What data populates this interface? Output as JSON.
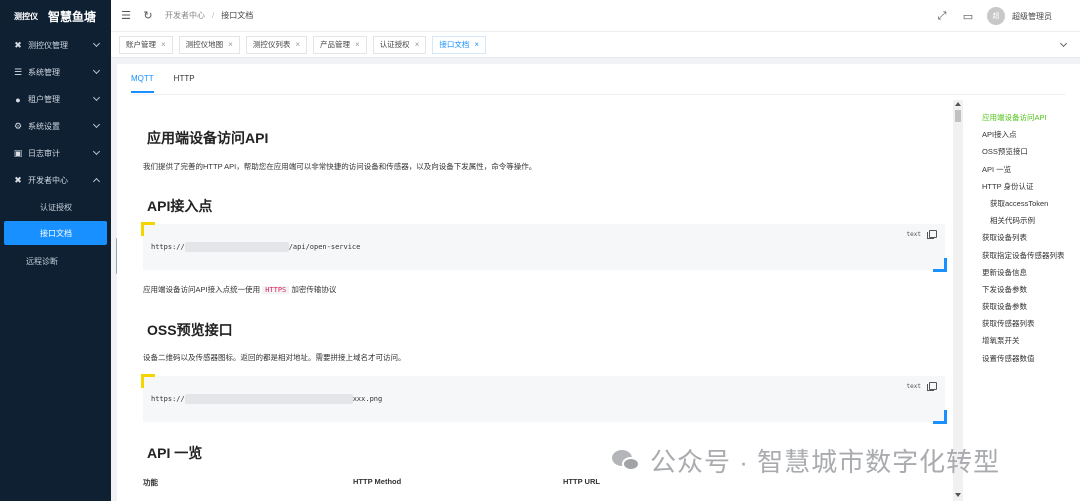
{
  "brand": {
    "small": "测控仪",
    "title": "智慧鱼塘"
  },
  "sidebar": {
    "items": [
      {
        "label": "测控仪管理",
        "icon": "tools-icon"
      },
      {
        "label": "系统管理",
        "icon": "sliders-icon"
      },
      {
        "label": "租户管理",
        "icon": "users-icon"
      },
      {
        "label": "系统设置",
        "icon": "gear-icon"
      },
      {
        "label": "日志审计",
        "icon": "calendar-icon"
      },
      {
        "label": "开发者中心",
        "icon": "tools-icon"
      }
    ],
    "sub_items": [
      {
        "label": "认证授权"
      },
      {
        "label": "接口文档"
      }
    ],
    "diag": {
      "label": "远程诊断"
    }
  },
  "topbar": {
    "breadcrumb": [
      "开发者中心",
      "接口文档"
    ],
    "separator": "/",
    "user": {
      "avatar_text": "超",
      "name": "超级管理员"
    }
  },
  "tabs": [
    {
      "label": "账户管理",
      "close": "×"
    },
    {
      "label": "测控仪地图",
      "close": "×"
    },
    {
      "label": "测控仪列表",
      "close": "×"
    },
    {
      "label": "产品管理",
      "close": "×"
    },
    {
      "label": "认证授权",
      "close": "×"
    },
    {
      "label": "接口文档",
      "close": "×"
    }
  ],
  "protocol_tabs": [
    "MQTT",
    "HTTP"
  ],
  "doc": {
    "h1": "应用端设备访问API",
    "intro": "我们提供了完善的HTTP API，帮助您在应用端可以非常快捷的访问设备和传感器，以及向设备下发属性，命令等操作。",
    "h2_endpoint": "API接入点",
    "code1": {
      "prefix": "https://",
      "suffix": "/api/open-service",
      "lang": "text"
    },
    "endpoint_note_pre": "应用端设备访问API接入点统一使用",
    "endpoint_note_code": "HTTPS",
    "endpoint_note_post": "加密传输协议",
    "h2_oss": "OSS预览接口",
    "oss_desc": "设备二维码以及传感器图标。返回的都是相对地址。需要拼接上域名才可访问。",
    "code2": {
      "prefix": "https://",
      "suffix": "xxx.png",
      "lang": "text"
    },
    "h2_list": "API 一览",
    "table_headers": [
      "功能",
      "HTTP Method",
      "HTTP URL"
    ]
  },
  "toc": [
    {
      "label": "应用端设备访问API",
      "active": true
    },
    {
      "label": "API接入点"
    },
    {
      "label": "OSS预览接口"
    },
    {
      "label": "API 一览"
    },
    {
      "label": "HTTP 身份认证"
    },
    {
      "label": "获取accessToken",
      "sub": true
    },
    {
      "label": "相关代码示例",
      "sub": true
    },
    {
      "label": "获取设备列表"
    },
    {
      "label": "获取指定设备传感器列表"
    },
    {
      "label": "更新设备信息"
    },
    {
      "label": "下发设备参数"
    },
    {
      "label": "获取设备参数"
    },
    {
      "label": "获取传感器列表"
    },
    {
      "label": "增氧泵开关"
    },
    {
      "label": "设置传感器数值"
    }
  ],
  "watermark": {
    "text": "公众号 · 智慧城市数字化转型"
  },
  "colors": {
    "sidebar_bg": "#0f2033",
    "accent": "#1890ff",
    "toc_active": "#52c41a",
    "inline_code": "#e0245e"
  }
}
